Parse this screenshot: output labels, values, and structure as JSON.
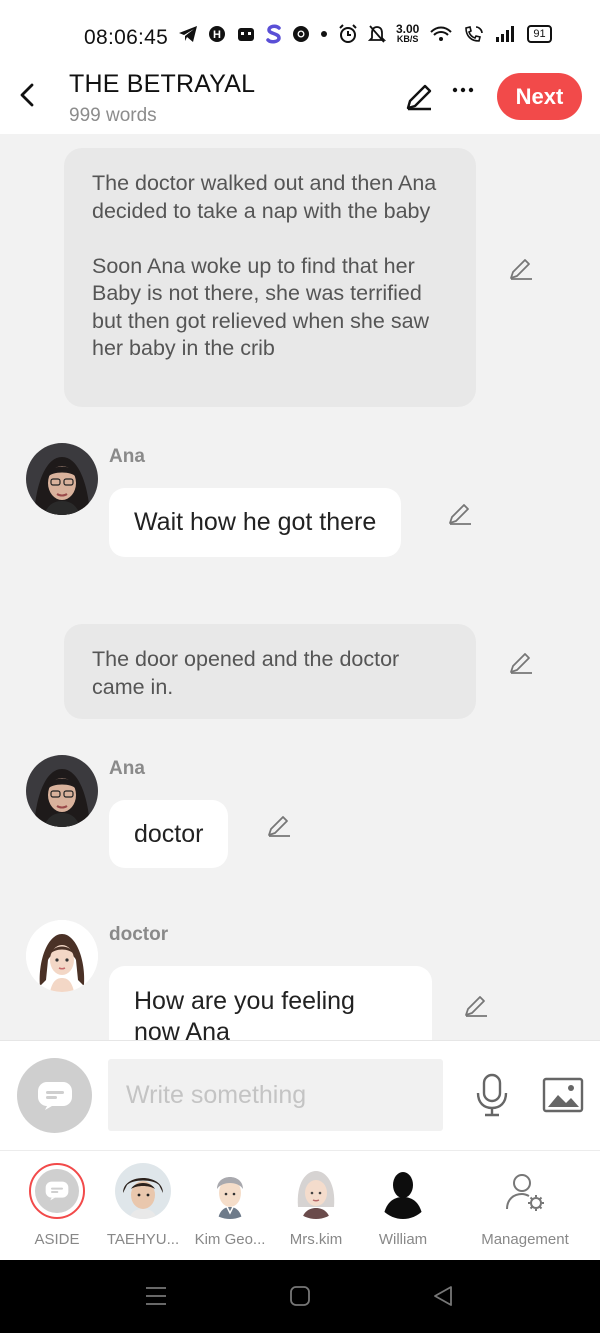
{
  "status": {
    "time": "08:06:45",
    "net_speed_value": "3.00",
    "net_speed_unit": "KB/S",
    "battery": "91"
  },
  "header": {
    "title": "THE BETRAYAL",
    "word_count": "999 words",
    "next_label": "Next"
  },
  "chat": {
    "narration_1": "The doctor walked out and then Ana decided to take a nap with the baby\n\nSoon Ana woke up to find that her Baby is not there, she was terrified but then got relieved when she saw her baby in the crib",
    "msg_1": {
      "speaker": "Ana",
      "text": "Wait how he got there"
    },
    "narration_2": "The door opened and the doctor came in.",
    "msg_2": {
      "speaker": "Ana",
      "text": "doctor"
    },
    "msg_3": {
      "speaker": "doctor",
      "text": "How are you feeling now Ana"
    }
  },
  "input": {
    "placeholder": "Write something"
  },
  "characters": [
    {
      "label": "ASIDE"
    },
    {
      "label": "TAEHYU..."
    },
    {
      "label": "Kim Geo..."
    },
    {
      "label": "Mrs.kim"
    },
    {
      "label": "William"
    },
    {
      "label": "Management"
    }
  ],
  "colors": {
    "accent": "#f24a4a",
    "background": "#f2f2f2",
    "narration_bg": "#e8e8e8"
  }
}
